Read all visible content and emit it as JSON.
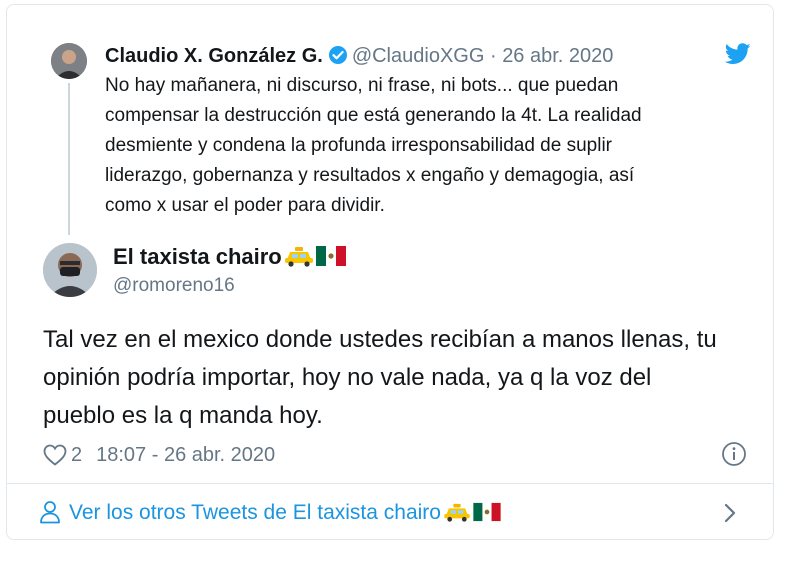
{
  "parent_tweet": {
    "name": "Claudio X. González G.",
    "handle": "@ClaudioXGG",
    "separator": "·",
    "date": "26 abr. 2020",
    "lines": [
      "No hay mañanera, ni discurso, ni frase, ni bots... que puedan",
      "compensar la destrucción que está generando la 4t. La realidad",
      "desmiente y condena la profunda irresponsabilidad de suplir",
      "liderazgo, gobernanza y resultados x engaño y demagogia, así",
      "como x usar el poder para dividir."
    ]
  },
  "reply_tweet": {
    "name": "El taxista chairo",
    "handle": "@romoreno16",
    "lines": [
      "Tal vez en el mexico donde ustedes recibían a manos llenas, tu",
      "opinión podría importar, hoy no vale nada, ya q la voz del",
      "pueblo es la q manda hoy."
    ],
    "like_count": "2",
    "timestamp": "18:07 - 26 abr. 2020"
  },
  "more_link": {
    "label": "Ver los otros Tweets de El taxista chairo"
  },
  "colors": {
    "brand_blue": "#1da1f2",
    "link_blue": "#1b95e0",
    "muted": "#657786",
    "border": "#e1e8ed"
  },
  "icons": [
    "twitter-bird-icon",
    "verified-badge-icon",
    "taxi-emoji-icon",
    "mexico-flag-emoji-icon",
    "heart-icon",
    "info-icon",
    "user-icon",
    "chevron-right-icon"
  ]
}
